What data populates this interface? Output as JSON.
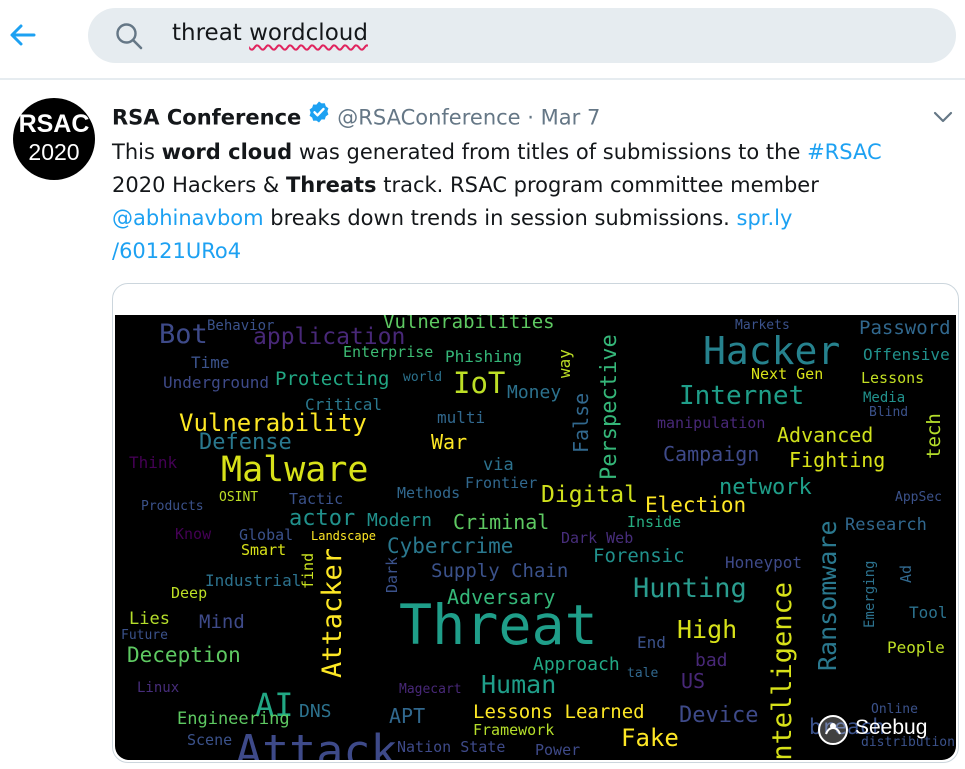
{
  "search": {
    "query_word1": "threat",
    "query_word2": "wordcloud"
  },
  "tweet": {
    "author_name": "RSA Conference",
    "handle": "@RSAConference",
    "separator": "·",
    "date": "Mar 7",
    "avatar": {
      "line1": "RSAC",
      "line2": "2020"
    },
    "text": {
      "t1": "This ",
      "b1": "word cloud",
      "t2": " was generated from titles of submissions to the ",
      "hashtag": "#RSAC",
      "t3": " 2020 Hackers & ",
      "b2": "Threats",
      "t4": " track. RSAC program committee member ",
      "mention": "@abhinavbom",
      "t5": " breaks down trends in session submissions. ",
      "link_part1": "spr.ly",
      "link_part2": "/60121URo4"
    }
  },
  "wordcloud": {
    "words": [
      {
        "text": "Behavior",
        "color": "#3b528b"
      },
      {
        "text": "Bot",
        "color": "#3e4a89"
      },
      {
        "text": "application",
        "color": "#482878"
      },
      {
        "text": "Vulnerabilities",
        "color": "#5ec962"
      },
      {
        "text": "Markets",
        "color": "#3b528b"
      },
      {
        "text": "Password",
        "color": "#31688e"
      },
      {
        "text": "Time",
        "color": "#3b528b"
      },
      {
        "text": "Enterprise",
        "color": "#3dbc74"
      },
      {
        "text": "Phishing",
        "color": "#35b779"
      },
      {
        "text": "way",
        "color": "#bddf26"
      },
      {
        "text": "Perspective",
        "color": "#35b779"
      },
      {
        "text": "Hacker",
        "color": "#26828e"
      },
      {
        "text": "Offensive",
        "color": "#21918c"
      },
      {
        "text": "Underground",
        "color": "#3e4a89"
      },
      {
        "text": "Protecting",
        "color": "#22a884"
      },
      {
        "text": "world",
        "color": "#2c728e"
      },
      {
        "text": "IoT",
        "color": "#bddf26"
      },
      {
        "text": "Money",
        "color": "#2c728e"
      },
      {
        "text": "Next Gen",
        "color": "#d8e219"
      },
      {
        "text": "Lessons",
        "color": "#c2df23"
      },
      {
        "text": "Media",
        "color": "#21918c"
      },
      {
        "text": "Critical",
        "color": "#2a788e"
      },
      {
        "text": "Internet",
        "color": "#1f9e89"
      },
      {
        "text": "Blind",
        "color": "#3b528b"
      },
      {
        "text": "multi",
        "color": "#31688e"
      },
      {
        "text": "False",
        "color": "#31688e"
      },
      {
        "text": "Vulnerability",
        "color": "#fde725"
      },
      {
        "text": "manipulation",
        "color": "#482878"
      },
      {
        "text": "Advanced",
        "color": "#d0e11c"
      },
      {
        "text": "tech",
        "color": "#b5de2b"
      },
      {
        "text": "Defense",
        "color": "#2a788e"
      },
      {
        "text": "War",
        "color": "#fde725"
      },
      {
        "text": "Campaign",
        "color": "#3e4a89"
      },
      {
        "text": "Fighting",
        "color": "#d8e219"
      },
      {
        "text": "Think",
        "color": "#440154"
      },
      {
        "text": "Malware",
        "color": "#d8e219"
      },
      {
        "text": "via",
        "color": "#2c728e"
      },
      {
        "text": "Frontier",
        "color": "#31688e"
      },
      {
        "text": "network",
        "color": "#1f9e89"
      },
      {
        "text": "OSINT",
        "color": "#bddf26"
      },
      {
        "text": "Tactic",
        "color": "#3b528b"
      },
      {
        "text": "Methods",
        "color": "#31688e"
      },
      {
        "text": "Digital",
        "color": "#d0e11c"
      },
      {
        "text": "Election",
        "color": "#fde725"
      },
      {
        "text": "AppSec",
        "color": "#3b528b"
      },
      {
        "text": "Products",
        "color": "#3b528b"
      },
      {
        "text": "actor",
        "color": "#21918c"
      },
      {
        "text": "Modern",
        "color": "#21918c"
      },
      {
        "text": "Criminal",
        "color": "#5ec962"
      },
      {
        "text": "Inside",
        "color": "#27ad81"
      },
      {
        "text": "Research",
        "color": "#31688e"
      },
      {
        "text": "Know",
        "color": "#440154"
      },
      {
        "text": "Global",
        "color": "#3b528b"
      },
      {
        "text": "Landscape",
        "color": "#fde725"
      },
      {
        "text": "Dark Web",
        "color": "#472d7b"
      },
      {
        "text": "Smart",
        "color": "#d8e219"
      },
      {
        "text": "Cybercrime",
        "color": "#2a788e"
      },
      {
        "text": "Forensic",
        "color": "#21918c"
      },
      {
        "text": "Honeypot",
        "color": "#3e4a89"
      },
      {
        "text": "Ransomware",
        "color": "#2a788e"
      },
      {
        "text": "find",
        "color": "#c8e020"
      },
      {
        "text": "Dark",
        "color": "#3b528b"
      },
      {
        "text": "Supply Chain",
        "color": "#3b528b"
      },
      {
        "text": "Emerging",
        "color": "#2c728e"
      },
      {
        "text": "Ad",
        "color": "#31688e"
      },
      {
        "text": "Industrial",
        "color": "#2c728e"
      },
      {
        "text": "Attacker",
        "color": "#fde725"
      },
      {
        "text": "Adversary",
        "color": "#35b779"
      },
      {
        "text": "Hunting",
        "color": "#2a9d8f"
      },
      {
        "text": "Deep",
        "color": "#bddf26"
      },
      {
        "text": "Intelligence",
        "color": "#d8e219"
      },
      {
        "text": "Tool",
        "color": "#2c728e"
      },
      {
        "text": "Lies",
        "color": "#b5de2b"
      },
      {
        "text": "Mind",
        "color": "#3e4a89"
      },
      {
        "text": "Future",
        "color": "#3b528b"
      },
      {
        "text": "Threat",
        "color": "#1f9e89"
      },
      {
        "text": "End",
        "color": "#3b528b"
      },
      {
        "text": "High",
        "color": "#d8e219"
      },
      {
        "text": "People",
        "color": "#bddf26"
      },
      {
        "text": "Deception",
        "color": "#5ec962"
      },
      {
        "text": "Approach",
        "color": "#22a884"
      },
      {
        "text": "tale",
        "color": "#31688e"
      },
      {
        "text": "bad",
        "color": "#482878"
      },
      {
        "text": "Linux",
        "color": "#472d7b"
      },
      {
        "text": "US",
        "color": "#482878"
      },
      {
        "text": "Magecart",
        "color": "#482878"
      },
      {
        "text": "Human",
        "color": "#1f9e89"
      },
      {
        "text": "AI",
        "color": "#22a884"
      },
      {
        "text": "Engineering",
        "color": "#5ec962"
      },
      {
        "text": "DNS",
        "color": "#2c728e"
      },
      {
        "text": "APT",
        "color": "#31688e"
      },
      {
        "text": "Lessons Learned",
        "color": "#fde725"
      },
      {
        "text": "Device",
        "color": "#3e4a89"
      },
      {
        "text": "Online",
        "color": "#3b528b"
      },
      {
        "text": "Scene",
        "color": "#3b528b"
      },
      {
        "text": "Framework",
        "color": "#b5de2b"
      },
      {
        "text": "Fake",
        "color": "#fde725"
      },
      {
        "text": "distribution",
        "color": "#3b528b"
      },
      {
        "text": "Attack",
        "color": "#3e4a89"
      },
      {
        "text": "Nation State",
        "color": "#3e4a89"
      },
      {
        "text": "Power",
        "color": "#3e4a89"
      },
      {
        "text": "breach",
        "color": "#3b528b"
      }
    ],
    "watermark": "Seebug"
  }
}
